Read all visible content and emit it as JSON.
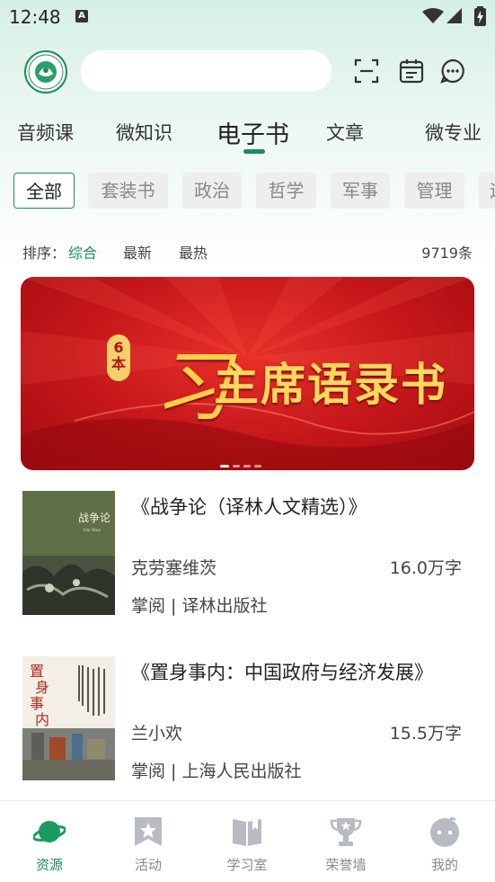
{
  "status_bar": {
    "time": "12:48",
    "a_icon": "A"
  },
  "header": {
    "logo_icon": "logo-icon",
    "search_placeholder": "",
    "icons": [
      "scan-icon",
      "calendar-icon",
      "message-icon"
    ]
  },
  "tabs": [
    {
      "label": "音频课",
      "active": false
    },
    {
      "label": "微知识",
      "active": false
    },
    {
      "label": "电子书",
      "active": true
    },
    {
      "label": "文章",
      "active": false
    },
    {
      "label": "微专业",
      "active": false
    }
  ],
  "categories": [
    {
      "label": "全部",
      "active": true
    },
    {
      "label": "套装书"
    },
    {
      "label": "政治"
    },
    {
      "label": "哲学"
    },
    {
      "label": "军事"
    },
    {
      "label": "管理"
    },
    {
      "label": "运"
    }
  ],
  "sort": {
    "label": "排序：",
    "options": [
      "综合",
      "最新",
      "最热"
    ],
    "active": "综合",
    "count": "9719条"
  },
  "banner": {
    "number_badge": "6本",
    "script_char": "习",
    "title": "主席语录书",
    "slide_count": 4,
    "active_slide": 0
  },
  "books": [
    {
      "title": "《战争论（译林人文精选）》",
      "author": "克劳塞维茨",
      "words": "16.0万字",
      "publisher": "掌阅 | 译林出版社",
      "cover_title": "战争论",
      "cover_subtitle": "On War"
    },
    {
      "title": "《置身事内：中国政府与经济发展》",
      "author": "兰小欢",
      "words": "15.5万字",
      "publisher": "掌阅 | 上海人民出版社",
      "cover_title": "置身事内"
    }
  ],
  "bottom_nav": [
    {
      "label": "资源",
      "icon": "planet-icon",
      "active": true
    },
    {
      "label": "活动",
      "icon": "star-bookmark-icon",
      "active": false
    },
    {
      "label": "学习室",
      "icon": "book-icon",
      "active": false
    },
    {
      "label": "荣誉墙",
      "icon": "trophy-icon",
      "active": false
    },
    {
      "label": "我的",
      "icon": "profile-icon",
      "active": false
    }
  ],
  "colors": {
    "accent": "#1b8c5a",
    "banner_red": "#c4161a",
    "banner_gold": "#ffd85e"
  }
}
